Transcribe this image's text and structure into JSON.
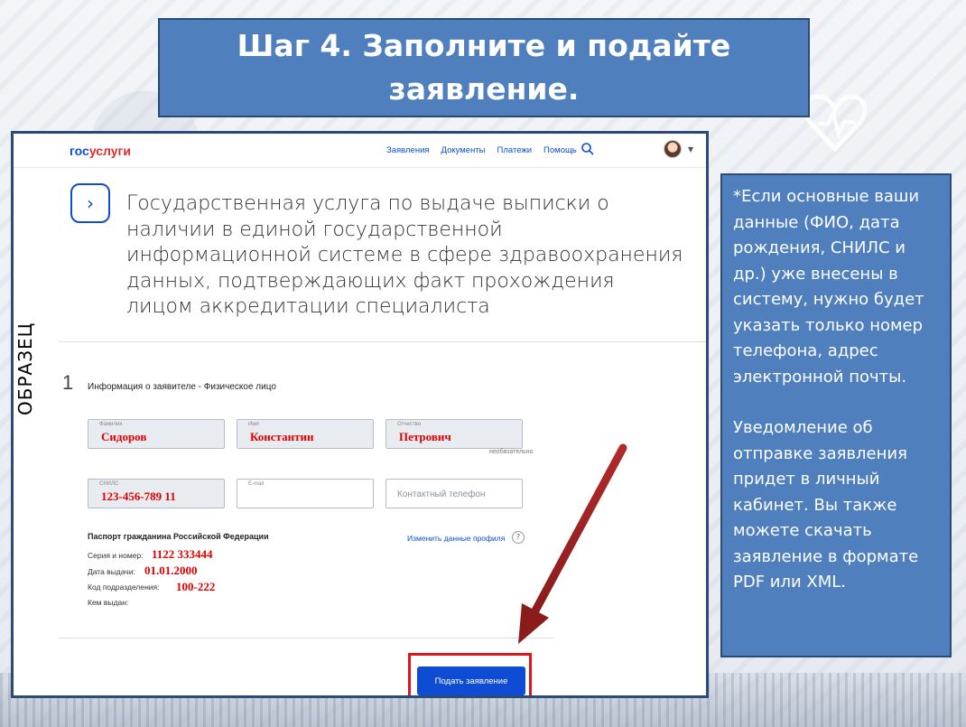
{
  "slide": {
    "title": "Шаг 4. Заполните и подайте заявление."
  },
  "header": {
    "logo_gos": "гос",
    "logo_usl": "услуги",
    "nav": [
      "Заявления",
      "Документы",
      "Платежи",
      "Помощь"
    ]
  },
  "service": {
    "title": "Государственная услуга по выдаче выписки о наличии в единой государственной информационной системе в сфере здравоохранения данных, подтверждающих факт прохождения лицом аккредитации специалиста"
  },
  "step": {
    "number": "1",
    "title": "Информация о заявителе - Физическое лицо"
  },
  "fields": {
    "surname": {
      "label": "Фамилия",
      "value": "Сидоров"
    },
    "name": {
      "label": "Имя",
      "value": "Константин"
    },
    "patronymic": {
      "label": "Отчество",
      "value": "Петрович",
      "note": "необязательно"
    },
    "snils": {
      "label": "СНИЛС",
      "value": "123-456-789 11"
    },
    "email": {
      "label": "E-mail",
      "value": ""
    },
    "phone": {
      "placeholder": "Контактный телефон"
    }
  },
  "passport": {
    "title": "Паспорт гражданина Российской Федерации",
    "change_link": "Изменить данные профиля",
    "help": "?",
    "series_label": "Серия и номер:",
    "series_value": "1122 333444",
    "date_label": "Дата выдачи:",
    "date_value": "01.01.2000",
    "code_label": "Код подразделения:",
    "code_value": "100-222",
    "issued_label": "Кем выдан:"
  },
  "submit_label": "Подать заявление",
  "watermark": "ОБРАЗЕЦ",
  "info": {
    "para1": "*Если основные ваши данные (ФИО, дата рождения, СНИЛС и др.) уже внесены в систему, нужно будет указать только номер телефона, адрес электронной почты.",
    "para2": "Уведомление об отправке заявления придет в личный кабинет. Вы также можете скачать заявление в формате PDF или XML."
  },
  "colors": {
    "banner": "#4f80bd",
    "brand_blue": "#0d4cd3",
    "highlight_red": "#e0161e",
    "arrow": "#b02a2a"
  }
}
